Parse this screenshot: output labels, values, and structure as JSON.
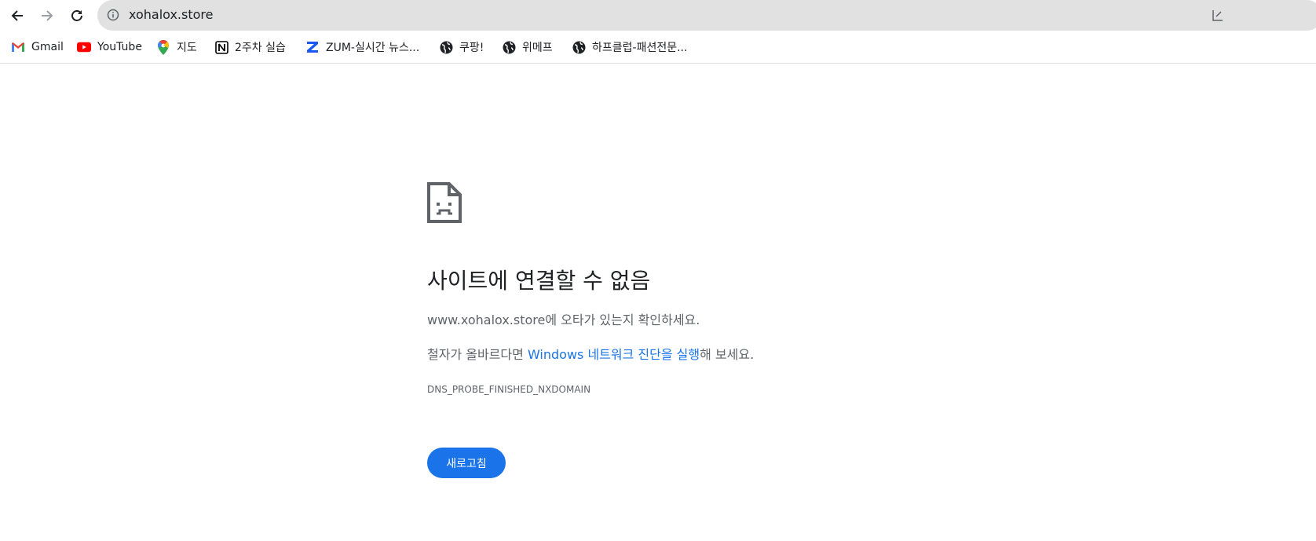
{
  "browser": {
    "url": "xohalox.store",
    "bookmarks": [
      {
        "label": "Gmail",
        "icon": "gmail-icon"
      },
      {
        "label": "YouTube",
        "icon": "youtube-icon"
      },
      {
        "label": "지도",
        "icon": "maps-pin-icon"
      },
      {
        "label": "2주차 실습",
        "icon": "notion-icon"
      },
      {
        "label": "ZUM-실시간 뉴스...",
        "icon": "zum-icon"
      },
      {
        "label": "쿠팡!",
        "icon": "globe-icon"
      },
      {
        "label": "위메프",
        "icon": "globe-icon"
      },
      {
        "label": "하프클럽-패션전문...",
        "icon": "globe-icon"
      }
    ]
  },
  "error": {
    "title": "사이트에 연결할 수 없음",
    "line1_host": "www.xohalox.store",
    "line1_rest": "에 오타가 있는지 확인하세요.",
    "line2_prefix": "철자가 올바르다면 ",
    "line2_link": "Windows 네트워크 진단을 실행",
    "line2_suffix": "해 보세요.",
    "code": "DNS_PROBE_FINISHED_NXDOMAIN",
    "reload_label": "새로고침"
  },
  "colors": {
    "accent": "#1a73e8",
    "omnibox_bg": "#e1e1e1",
    "secondary_text": "#5f6368"
  }
}
